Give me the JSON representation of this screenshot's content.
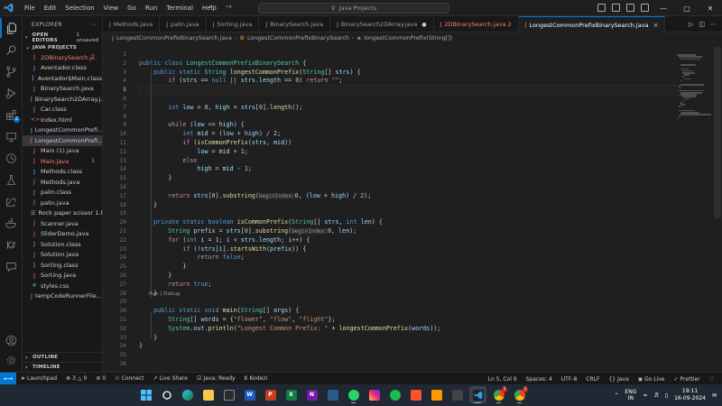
{
  "titlebar": {
    "menus": [
      "File",
      "Edit",
      "Selection",
      "View",
      "Go",
      "Run",
      "Terminal",
      "Help"
    ],
    "search_text": "Java Projects"
  },
  "activity": {
    "source_control_badge": "1",
    "extensions_badge": "2"
  },
  "sidebar": {
    "title": "EXPLORER",
    "open_editors_label": "OPEN EDITORS",
    "open_editors_extra": "1 unsaved",
    "project_label": "JAVA PROJECTS",
    "files": [
      {
        "name": "2DBinarySearch.j...",
        "kind": "java",
        "error": true,
        "badge": "2"
      },
      {
        "name": "Aventador.class",
        "kind": "class"
      },
      {
        "name": "Aventador$Main.class",
        "kind": "class"
      },
      {
        "name": "BinarySearch.java",
        "kind": "java"
      },
      {
        "name": "BinarySearch2DArray.j...",
        "kind": "java"
      },
      {
        "name": "Car.class",
        "kind": "class"
      },
      {
        "name": "Index.html",
        "kind": "html"
      },
      {
        "name": "LongestCommonPrefi...",
        "kind": "class"
      },
      {
        "name": "LongestCommonPrefi...",
        "kind": "java",
        "selected": true
      },
      {
        "name": "Main (1).java",
        "kind": "java"
      },
      {
        "name": "Main.java",
        "kind": "java",
        "error": true,
        "badge": "1"
      },
      {
        "name": "Methods.class",
        "kind": "class"
      },
      {
        "name": "Methods.java",
        "kind": "java"
      },
      {
        "name": "palin.class",
        "kind": "class"
      },
      {
        "name": "palin.java",
        "kind": "java"
      },
      {
        "name": "Rock paper scissor 1.h...",
        "kind": "other"
      },
      {
        "name": "Scanner.java",
        "kind": "java"
      },
      {
        "name": "SliderDemo.java",
        "kind": "java"
      },
      {
        "name": "Solution.class",
        "kind": "class"
      },
      {
        "name": "Solution.java",
        "kind": "java"
      },
      {
        "name": "Sorting.class",
        "kind": "class"
      },
      {
        "name": "Sorting.java",
        "kind": "java"
      },
      {
        "name": "styles.css",
        "kind": "css"
      },
      {
        "name": "tempCodeRunnerFile...",
        "kind": "java"
      }
    ],
    "outline_label": "OUTLINE",
    "timeline_label": "TIMELINE"
  },
  "tabs": [
    {
      "label": "Methods.java",
      "active": false,
      "error": false
    },
    {
      "label": "palin.java",
      "active": false,
      "error": false
    },
    {
      "label": "Sorting.java",
      "active": false,
      "error": false
    },
    {
      "label": "BinarySearch.java",
      "active": false,
      "error": false
    },
    {
      "label": "BinarySearch2DArray.java",
      "active": false,
      "error": false,
      "dirty": true
    },
    {
      "label": "2DBinarySearch.java 2",
      "active": false,
      "error": true
    },
    {
      "label": "LongestCommonPrefixBinarySearch.java",
      "active": true,
      "error": false
    }
  ],
  "breadcrumb": {
    "file": "LongestCommonPrefixBinarySearch.java",
    "class": "LongestCommonPrefixBinarySearch",
    "method": "longestCommonPrefix(String[])"
  },
  "editor": {
    "current_line": 5,
    "codelens": "Run | Debug",
    "codelens_after_line": 28,
    "line_numbers": [
      "1",
      "2",
      "3",
      "4",
      "5",
      "6",
      "7",
      "8",
      "9",
      "10",
      "11",
      "12",
      "13",
      "14",
      "15",
      "16",
      "17",
      "18",
      "19",
      "20",
      "21",
      "22",
      "23",
      "24",
      "25",
      "26",
      "27",
      "28",
      "29",
      "30",
      "31",
      "32",
      "33",
      "34",
      "35",
      "36"
    ],
    "lines": [
      [],
      [
        [
          "k",
          "public "
        ],
        [
          "k",
          "class "
        ],
        [
          "t",
          "LongestCommonPrefixBinarySearch"
        ],
        [
          "p",
          " {"
        ]
      ],
      [
        [
          "p",
          "    "
        ],
        [
          "k",
          "public "
        ],
        [
          "k",
          "static "
        ],
        [
          "t",
          "String "
        ],
        [
          "f",
          "longestCommonPrefix"
        ],
        [
          "p",
          "("
        ],
        [
          "t",
          "String"
        ],
        [
          "p",
          "[] "
        ],
        [
          "v",
          "strs"
        ],
        [
          "p",
          ") {"
        ]
      ],
      [
        [
          "p",
          "        "
        ],
        [
          "kc",
          "if "
        ],
        [
          "p",
          "("
        ],
        [
          "v",
          "strs"
        ],
        [
          "p",
          " == "
        ],
        [
          "k",
          "null"
        ],
        [
          "p",
          " || "
        ],
        [
          "v",
          "strs"
        ],
        [
          "p",
          "."
        ],
        [
          "v",
          "length"
        ],
        [
          "p",
          " == "
        ],
        [
          "n",
          "0"
        ],
        [
          "p",
          ") "
        ],
        [
          "kc",
          "return "
        ],
        [
          "s",
          "\"\""
        ],
        [
          "p",
          ";"
        ]
      ],
      [],
      [],
      [
        [
          "p",
          "        "
        ],
        [
          "k",
          "int "
        ],
        [
          "v",
          "low"
        ],
        [
          "p",
          " = "
        ],
        [
          "n",
          "0"
        ],
        [
          "p",
          ", "
        ],
        [
          "v",
          "high"
        ],
        [
          "p",
          " = "
        ],
        [
          "v",
          "strs"
        ],
        [
          "p",
          "["
        ],
        [
          "n",
          "0"
        ],
        [
          "p",
          "]."
        ],
        [
          "f",
          "length"
        ],
        [
          "p",
          "();"
        ]
      ],
      [],
      [
        [
          "p",
          "        "
        ],
        [
          "kc",
          "while "
        ],
        [
          "p",
          "("
        ],
        [
          "v",
          "low"
        ],
        [
          "p",
          " <= "
        ],
        [
          "v",
          "high"
        ],
        [
          "p",
          ") {"
        ]
      ],
      [
        [
          "p",
          "            "
        ],
        [
          "k",
          "int "
        ],
        [
          "v",
          "mid"
        ],
        [
          "p",
          " = ("
        ],
        [
          "v",
          "low"
        ],
        [
          "p",
          " + "
        ],
        [
          "v",
          "high"
        ],
        [
          "p",
          ") / "
        ],
        [
          "n",
          "2"
        ],
        [
          "p",
          ";"
        ]
      ],
      [
        [
          "p",
          "            "
        ],
        [
          "kc",
          "if "
        ],
        [
          "p",
          "("
        ],
        [
          "f",
          "isCommonPrefix"
        ],
        [
          "p",
          "("
        ],
        [
          "v",
          "strs"
        ],
        [
          "p",
          ", "
        ],
        [
          "v",
          "mid"
        ],
        [
          "p",
          "))"
        ]
      ],
      [
        [
          "p",
          "                "
        ],
        [
          "v",
          "low"
        ],
        [
          "p",
          " = "
        ],
        [
          "v",
          "mid"
        ],
        [
          "p",
          " + "
        ],
        [
          "n",
          "1"
        ],
        [
          "p",
          ";"
        ]
      ],
      [
        [
          "p",
          "            "
        ],
        [
          "kc",
          "else"
        ]
      ],
      [
        [
          "p",
          "                "
        ],
        [
          "v",
          "high"
        ],
        [
          "p",
          " = "
        ],
        [
          "v",
          "mid"
        ],
        [
          "p",
          " - "
        ],
        [
          "n",
          "1"
        ],
        [
          "p",
          ";"
        ]
      ],
      [
        [
          "p",
          "        }"
        ]
      ],
      [],
      [
        [
          "p",
          "        "
        ],
        [
          "kc",
          "return "
        ],
        [
          "v",
          "strs"
        ],
        [
          "p",
          "["
        ],
        [
          "n",
          "0"
        ],
        [
          "p",
          "]."
        ],
        [
          "f",
          "substring"
        ],
        [
          "p",
          "("
        ],
        [
          "h",
          "beginIndex:"
        ],
        [
          "n",
          "0"
        ],
        [
          "p",
          ", ("
        ],
        [
          "v",
          "low"
        ],
        [
          "p",
          " + "
        ],
        [
          "v",
          "high"
        ],
        [
          "p",
          ") / "
        ],
        [
          "n",
          "2"
        ],
        [
          "p",
          ");"
        ]
      ],
      [
        [
          "p",
          "    }"
        ]
      ],
      [],
      [
        [
          "p",
          "    "
        ],
        [
          "k",
          "private "
        ],
        [
          "k",
          "static "
        ],
        [
          "k",
          "boolean "
        ],
        [
          "f",
          "isCommonPrefix"
        ],
        [
          "p",
          "("
        ],
        [
          "t",
          "String"
        ],
        [
          "p",
          "[] "
        ],
        [
          "v",
          "strs"
        ],
        [
          "p",
          ", "
        ],
        [
          "k",
          "int "
        ],
        [
          "v",
          "len"
        ],
        [
          "p",
          ") {"
        ]
      ],
      [
        [
          "p",
          "        "
        ],
        [
          "t",
          "String "
        ],
        [
          "v",
          "prefix"
        ],
        [
          "p",
          " = "
        ],
        [
          "v",
          "strs"
        ],
        [
          "p",
          "["
        ],
        [
          "n",
          "0"
        ],
        [
          "p",
          "]."
        ],
        [
          "f",
          "substring"
        ],
        [
          "p",
          "("
        ],
        [
          "h",
          "beginIndex:"
        ],
        [
          "n",
          "0"
        ],
        [
          "p",
          ", "
        ],
        [
          "v",
          "len"
        ],
        [
          "p",
          ");"
        ]
      ],
      [
        [
          "p",
          "        "
        ],
        [
          "kc",
          "for "
        ],
        [
          "p",
          "("
        ],
        [
          "k",
          "int "
        ],
        [
          "v",
          "i"
        ],
        [
          "p",
          " = "
        ],
        [
          "n",
          "1"
        ],
        [
          "p",
          "; "
        ],
        [
          "v",
          "i"
        ],
        [
          "p",
          " < "
        ],
        [
          "v",
          "strs"
        ],
        [
          "p",
          "."
        ],
        [
          "v",
          "length"
        ],
        [
          "p",
          "; "
        ],
        [
          "v",
          "i"
        ],
        [
          "p",
          "++) {"
        ]
      ],
      [
        [
          "p",
          "            "
        ],
        [
          "kc",
          "if "
        ],
        [
          "p",
          "(!"
        ],
        [
          "v",
          "strs"
        ],
        [
          "p",
          "["
        ],
        [
          "v",
          "i"
        ],
        [
          "p",
          "]."
        ],
        [
          "f",
          "startsWith"
        ],
        [
          "p",
          "("
        ],
        [
          "v",
          "prefix"
        ],
        [
          "p",
          ")) {"
        ]
      ],
      [
        [
          "p",
          "                "
        ],
        [
          "kc",
          "return "
        ],
        [
          "k",
          "false"
        ],
        [
          "p",
          ";"
        ]
      ],
      [
        [
          "p",
          "            }"
        ]
      ],
      [
        [
          "p",
          "        }"
        ]
      ],
      [
        [
          "p",
          "        "
        ],
        [
          "kc",
          "return "
        ],
        [
          "k",
          "true"
        ],
        [
          "p",
          ";"
        ]
      ],
      [
        [
          "p",
          "    }"
        ]
      ],
      [],
      [
        [
          "p",
          "    "
        ],
        [
          "k",
          "public "
        ],
        [
          "k",
          "static "
        ],
        [
          "k",
          "void "
        ],
        [
          "f",
          "main"
        ],
        [
          "p",
          "("
        ],
        [
          "t",
          "String"
        ],
        [
          "p",
          "[] "
        ],
        [
          "v",
          "args"
        ],
        [
          "p",
          ") {"
        ]
      ],
      [
        [
          "p",
          "        "
        ],
        [
          "t",
          "String"
        ],
        [
          "p",
          "[] "
        ],
        [
          "v",
          "words"
        ],
        [
          "p",
          " = {"
        ],
        [
          "s",
          "\"flower\""
        ],
        [
          "p",
          ", "
        ],
        [
          "s",
          "\"flow\""
        ],
        [
          "p",
          ", "
        ],
        [
          "s",
          "\"flight\""
        ],
        [
          "p",
          "};"
        ]
      ],
      [
        [
          "p",
          "        "
        ],
        [
          "t",
          "System"
        ],
        [
          "p",
          "."
        ],
        [
          "v",
          "out"
        ],
        [
          "p",
          "."
        ],
        [
          "f",
          "println"
        ],
        [
          "p",
          "("
        ],
        [
          "s",
          "\"Longest Common Prefix: \""
        ],
        [
          "p",
          " + "
        ],
        [
          "f",
          "longestCommonPrefix"
        ],
        [
          "p",
          "("
        ],
        [
          "v",
          "words"
        ],
        [
          "p",
          "));"
        ]
      ],
      [
        [
          "p",
          "    }"
        ]
      ],
      [
        [
          "p",
          "}"
        ]
      ],
      [],
      []
    ]
  },
  "statusbar": {
    "launchpad": "Launchpad",
    "errors": "3",
    "warnings": "0",
    "ports": "0",
    "connect": "Connect",
    "live_share": "Live Share",
    "java_status": "Java: Ready",
    "kodezi": "Kodezi",
    "position": "Ln 5, Col 9",
    "spaces": "Spaces: 4",
    "encoding": "UTF-8",
    "eol": "CRLF",
    "language": "Java",
    "go_live": "Go Live",
    "prettier": "Prettier"
  },
  "taskbar": {
    "lang_line1": "ENG",
    "lang_line2": "IN",
    "time": "19:11",
    "date": "16-09-2024",
    "badge_chrome1": "5",
    "badge_chrome2": "2"
  }
}
